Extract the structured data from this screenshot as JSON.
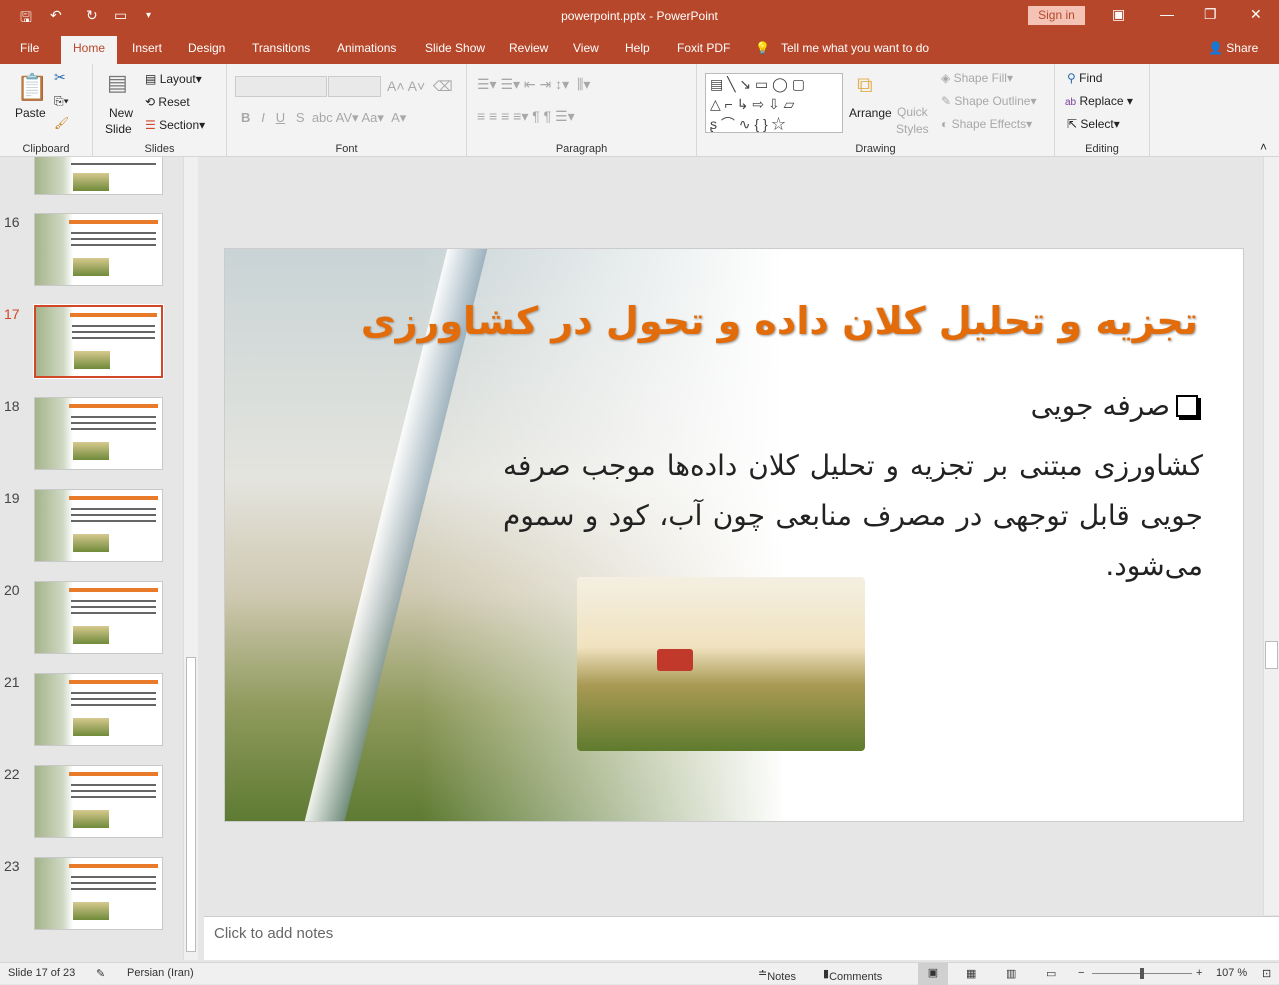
{
  "app": {
    "title": "powerpoint.pptx  -  PowerPoint",
    "sign_in": "Sign in",
    "share": "Share"
  },
  "tabs": [
    "File",
    "Home",
    "Insert",
    "Design",
    "Transitions",
    "Animations",
    "Slide Show",
    "Review",
    "View",
    "Help",
    "Foxit PDF"
  ],
  "tell_me": "Tell me what you want to do",
  "ribbon": {
    "clipboard": {
      "label": "Clipboard",
      "paste": "Paste"
    },
    "slides": {
      "label": "Slides",
      "new_slide_1": "New",
      "new_slide_2": "Slide",
      "layout": "Layout",
      "reset": "Reset",
      "section": "Section"
    },
    "font": {
      "label": "Font"
    },
    "paragraph": {
      "label": "Paragraph"
    },
    "drawing": {
      "label": "Drawing",
      "arrange": "Arrange",
      "quick_styles_1": "Quick",
      "quick_styles_2": "Styles",
      "shape_fill": "Shape Fill",
      "shape_outline": "Shape Outline",
      "shape_effects": "Shape Effects"
    },
    "editing": {
      "label": "Editing",
      "find": "Find",
      "replace": "Replace",
      "select": "Select"
    }
  },
  "thumbnails": [
    {
      "num": "16"
    },
    {
      "num": "17",
      "selected": true
    },
    {
      "num": "18"
    },
    {
      "num": "19"
    },
    {
      "num": "20"
    },
    {
      "num": "21"
    },
    {
      "num": "22"
    },
    {
      "num": "23"
    }
  ],
  "slide": {
    "title": "تجزیه و تحلیل کلان داده  و تحول در کشاورزی",
    "bullet": "صرفه جویی",
    "body": "کشاورزی مبتنی بر تجزیه و تحلیل کلان داده‌ها موجب صرفه جویی قابل توجهی در مصرف منابعی چون آب، کود و سموم می‌شود."
  },
  "notes_placeholder": "Click to add notes",
  "status": {
    "slide": "Slide 17 of 23",
    "language": "Persian (Iran)",
    "notes": "Notes",
    "comments": "Comments",
    "zoom": "107 %"
  },
  "colors": {
    "accent": "#b7472a",
    "title": "#e36c0a"
  }
}
